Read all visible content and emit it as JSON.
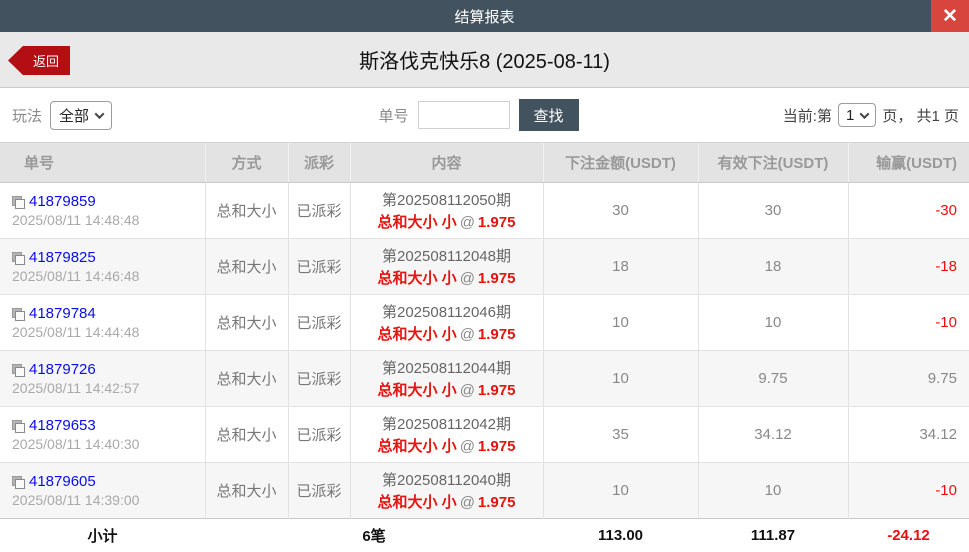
{
  "titlebar": {
    "title": "结算报表",
    "close_icon": "✕"
  },
  "header": {
    "back_label": "返回",
    "title": "斯洛伐克快乐8 (2025-08-11)"
  },
  "filters": {
    "play_label": "玩法",
    "play_value": "全部",
    "order_label": "单号",
    "order_input_value": "",
    "search_label": "查找",
    "page_prefix": "当前:第",
    "page_value": "1",
    "page_suffix": "页， 共1 页"
  },
  "table": {
    "columns": [
      "单号",
      "方式",
      "派彩",
      "内容",
      "下注金额(USDT)",
      "有效下注(USDT)",
      "输赢(USDT)"
    ],
    "rows": [
      {
        "order_no": "41879859",
        "time": "2025/08/11 14:48:48",
        "method": "总和大小",
        "payout": "已派彩",
        "period": "第202508112050期",
        "pick": "总和大小 小",
        "at": "@",
        "odds": "1.975",
        "bet": "30",
        "valid": "30",
        "winloss": "-30"
      },
      {
        "order_no": "41879825",
        "time": "2025/08/11 14:46:48",
        "method": "总和大小",
        "payout": "已派彩",
        "period": "第202508112048期",
        "pick": "总和大小 小",
        "at": "@",
        "odds": "1.975",
        "bet": "18",
        "valid": "18",
        "winloss": "-18"
      },
      {
        "order_no": "41879784",
        "time": "2025/08/11 14:44:48",
        "method": "总和大小",
        "payout": "已派彩",
        "period": "第202508112046期",
        "pick": "总和大小 小",
        "at": "@",
        "odds": "1.975",
        "bet": "10",
        "valid": "10",
        "winloss": "-10"
      },
      {
        "order_no": "41879726",
        "time": "2025/08/11 14:42:57",
        "method": "总和大小",
        "payout": "已派彩",
        "period": "第202508112044期",
        "pick": "总和大小 小",
        "at": "@",
        "odds": "1.975",
        "bet": "10",
        "valid": "9.75",
        "winloss": "9.75"
      },
      {
        "order_no": "41879653",
        "time": "2025/08/11 14:40:30",
        "method": "总和大小",
        "payout": "已派彩",
        "period": "第202508112042期",
        "pick": "总和大小 小",
        "at": "@",
        "odds": "1.975",
        "bet": "35",
        "valid": "34.12",
        "winloss": "34.12"
      },
      {
        "order_no": "41879605",
        "time": "2025/08/11 14:39:00",
        "method": "总和大小",
        "payout": "已派彩",
        "period": "第202508112040期",
        "pick": "总和大小 小",
        "at": "@",
        "odds": "1.975",
        "bet": "10",
        "valid": "10",
        "winloss": "-10"
      }
    ],
    "footer": {
      "label": "小计",
      "count": "6笔",
      "bet_total": "113.00",
      "valid_total": "111.87",
      "winloss_total": "-24.12"
    }
  },
  "colors": {
    "titlebar_bg": "#42525f",
    "close_red": "#d8453e",
    "back_red": "#b30e13",
    "link_blue": "#0b0bee",
    "loss_red": "#f20d0d",
    "pick_red": "#e8120f",
    "header_bg": "#e3e3e3"
  }
}
